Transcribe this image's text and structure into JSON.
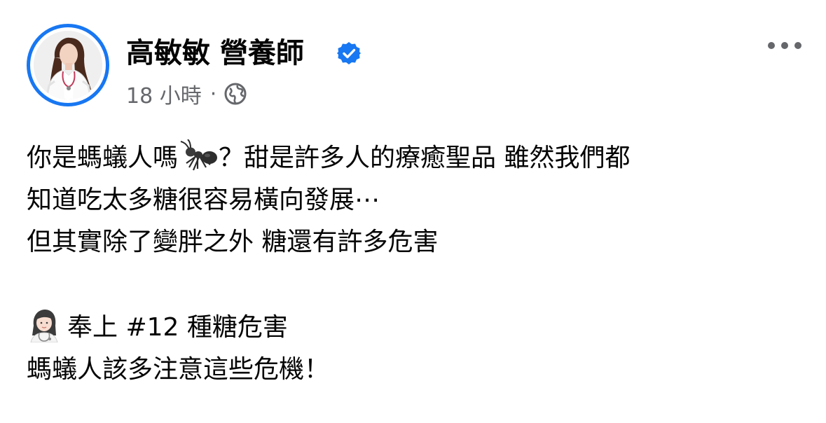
{
  "post": {
    "author": {
      "name": "高敏敏 營養師",
      "verified": true,
      "avatar_icon": "profile-photo"
    },
    "meta": {
      "timestamp": "18 小時",
      "separator": "·",
      "audience_icon": "globe-icon"
    },
    "menu_icon": "more-options-icon",
    "text": {
      "line1_a": "你是螞蟻人嗎",
      "line1_emoji": "ant-emoji",
      "line1_b": "？甜是許多人的療癒聖品 雖然我們都",
      "line2": "知道吃太多糖很容易橫向發展⋯",
      "line3": "但其實除了變胖之外 糖還有許多危害",
      "line4_emoji": "woman-health-worker-emoji",
      "line4": "奉上 #12 種糖危害",
      "line5": "螞蟻人該多注意這些危機！"
    },
    "colors": {
      "accent": "#1877f2",
      "text": "#050505",
      "secondary": "#65676b"
    }
  }
}
